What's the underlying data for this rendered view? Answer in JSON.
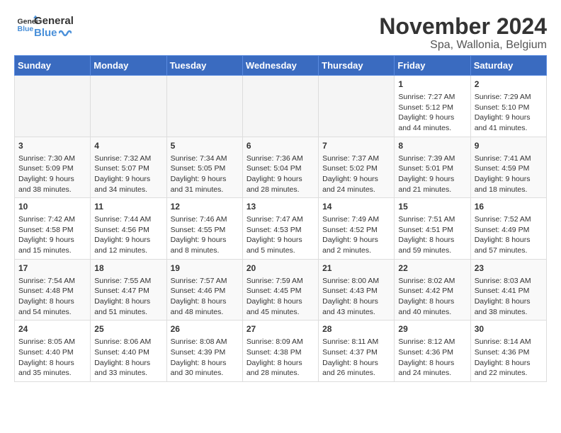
{
  "header": {
    "logo_line1": "General",
    "logo_line2": "Blue",
    "title": "November 2024",
    "subtitle": "Spa, Wallonia, Belgium"
  },
  "weekdays": [
    "Sunday",
    "Monday",
    "Tuesday",
    "Wednesday",
    "Thursday",
    "Friday",
    "Saturday"
  ],
  "weeks": [
    [
      {
        "day": "",
        "info": ""
      },
      {
        "day": "",
        "info": ""
      },
      {
        "day": "",
        "info": ""
      },
      {
        "day": "",
        "info": ""
      },
      {
        "day": "",
        "info": ""
      },
      {
        "day": "1",
        "info": "Sunrise: 7:27 AM\nSunset: 5:12 PM\nDaylight: 9 hours and 44 minutes."
      },
      {
        "day": "2",
        "info": "Sunrise: 7:29 AM\nSunset: 5:10 PM\nDaylight: 9 hours and 41 minutes."
      }
    ],
    [
      {
        "day": "3",
        "info": "Sunrise: 7:30 AM\nSunset: 5:09 PM\nDaylight: 9 hours and 38 minutes."
      },
      {
        "day": "4",
        "info": "Sunrise: 7:32 AM\nSunset: 5:07 PM\nDaylight: 9 hours and 34 minutes."
      },
      {
        "day": "5",
        "info": "Sunrise: 7:34 AM\nSunset: 5:05 PM\nDaylight: 9 hours and 31 minutes."
      },
      {
        "day": "6",
        "info": "Sunrise: 7:36 AM\nSunset: 5:04 PM\nDaylight: 9 hours and 28 minutes."
      },
      {
        "day": "7",
        "info": "Sunrise: 7:37 AM\nSunset: 5:02 PM\nDaylight: 9 hours and 24 minutes."
      },
      {
        "day": "8",
        "info": "Sunrise: 7:39 AM\nSunset: 5:01 PM\nDaylight: 9 hours and 21 minutes."
      },
      {
        "day": "9",
        "info": "Sunrise: 7:41 AM\nSunset: 4:59 PM\nDaylight: 9 hours and 18 minutes."
      }
    ],
    [
      {
        "day": "10",
        "info": "Sunrise: 7:42 AM\nSunset: 4:58 PM\nDaylight: 9 hours and 15 minutes."
      },
      {
        "day": "11",
        "info": "Sunrise: 7:44 AM\nSunset: 4:56 PM\nDaylight: 9 hours and 12 minutes."
      },
      {
        "day": "12",
        "info": "Sunrise: 7:46 AM\nSunset: 4:55 PM\nDaylight: 9 hours and 8 minutes."
      },
      {
        "day": "13",
        "info": "Sunrise: 7:47 AM\nSunset: 4:53 PM\nDaylight: 9 hours and 5 minutes."
      },
      {
        "day": "14",
        "info": "Sunrise: 7:49 AM\nSunset: 4:52 PM\nDaylight: 9 hours and 2 minutes."
      },
      {
        "day": "15",
        "info": "Sunrise: 7:51 AM\nSunset: 4:51 PM\nDaylight: 8 hours and 59 minutes."
      },
      {
        "day": "16",
        "info": "Sunrise: 7:52 AM\nSunset: 4:49 PM\nDaylight: 8 hours and 57 minutes."
      }
    ],
    [
      {
        "day": "17",
        "info": "Sunrise: 7:54 AM\nSunset: 4:48 PM\nDaylight: 8 hours and 54 minutes."
      },
      {
        "day": "18",
        "info": "Sunrise: 7:55 AM\nSunset: 4:47 PM\nDaylight: 8 hours and 51 minutes."
      },
      {
        "day": "19",
        "info": "Sunrise: 7:57 AM\nSunset: 4:46 PM\nDaylight: 8 hours and 48 minutes."
      },
      {
        "day": "20",
        "info": "Sunrise: 7:59 AM\nSunset: 4:45 PM\nDaylight: 8 hours and 45 minutes."
      },
      {
        "day": "21",
        "info": "Sunrise: 8:00 AM\nSunset: 4:43 PM\nDaylight: 8 hours and 43 minutes."
      },
      {
        "day": "22",
        "info": "Sunrise: 8:02 AM\nSunset: 4:42 PM\nDaylight: 8 hours and 40 minutes."
      },
      {
        "day": "23",
        "info": "Sunrise: 8:03 AM\nSunset: 4:41 PM\nDaylight: 8 hours and 38 minutes."
      }
    ],
    [
      {
        "day": "24",
        "info": "Sunrise: 8:05 AM\nSunset: 4:40 PM\nDaylight: 8 hours and 35 minutes."
      },
      {
        "day": "25",
        "info": "Sunrise: 8:06 AM\nSunset: 4:40 PM\nDaylight: 8 hours and 33 minutes."
      },
      {
        "day": "26",
        "info": "Sunrise: 8:08 AM\nSunset: 4:39 PM\nDaylight: 8 hours and 30 minutes."
      },
      {
        "day": "27",
        "info": "Sunrise: 8:09 AM\nSunset: 4:38 PM\nDaylight: 8 hours and 28 minutes."
      },
      {
        "day": "28",
        "info": "Sunrise: 8:11 AM\nSunset: 4:37 PM\nDaylight: 8 hours and 26 minutes."
      },
      {
        "day": "29",
        "info": "Sunrise: 8:12 AM\nSunset: 4:36 PM\nDaylight: 8 hours and 24 minutes."
      },
      {
        "day": "30",
        "info": "Sunrise: 8:14 AM\nSunset: 4:36 PM\nDaylight: 8 hours and 22 minutes."
      }
    ]
  ]
}
